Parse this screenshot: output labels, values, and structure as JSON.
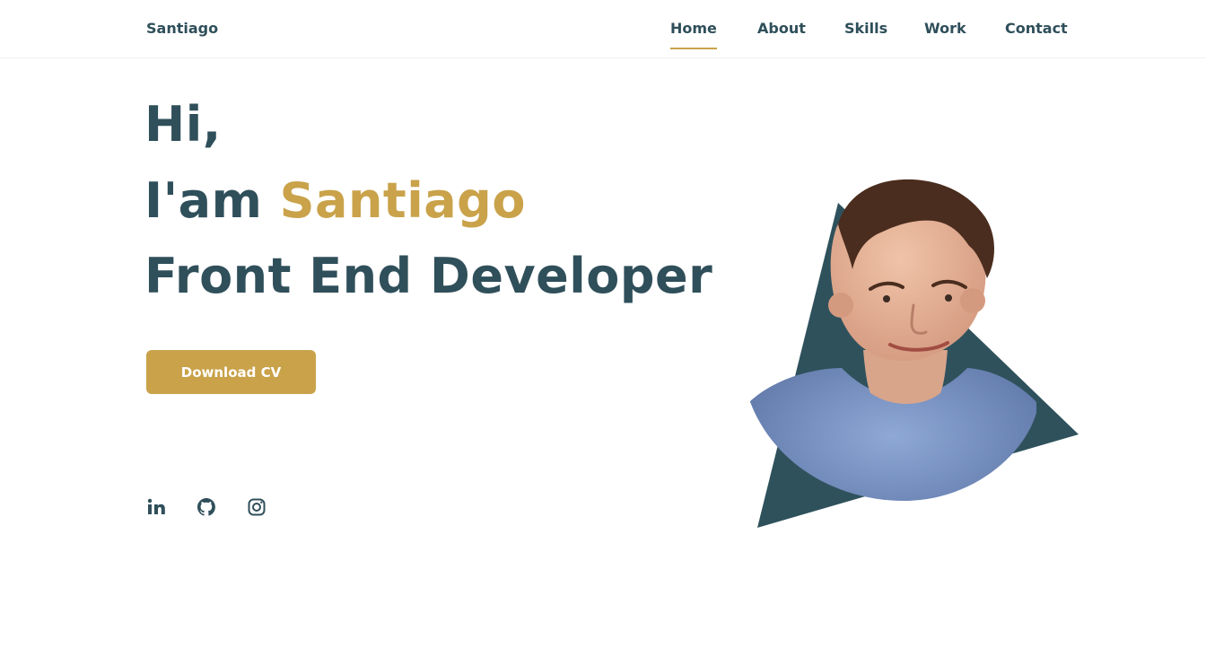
{
  "header": {
    "logo": "Santiago",
    "nav": [
      {
        "label": "Home",
        "active": true
      },
      {
        "label": "About",
        "active": false
      },
      {
        "label": "Skills",
        "active": false
      },
      {
        "label": "Work",
        "active": false
      },
      {
        "label": "Contact",
        "active": false
      }
    ]
  },
  "hero": {
    "greeting": "Hi,",
    "intro_prefix": "I'am ",
    "name": "Santiago",
    "role": "Front End Developer",
    "cta_label": "Download CV"
  },
  "social": [
    {
      "name": "linkedin",
      "icon": "linkedin-icon"
    },
    {
      "name": "github",
      "icon": "github-icon"
    },
    {
      "name": "instagram",
      "icon": "instagram-icon"
    }
  ],
  "colors": {
    "primary": "#2f4f5a",
    "accent": "#c9a24a",
    "shape": "#2f515c",
    "background": "#ffffff"
  }
}
